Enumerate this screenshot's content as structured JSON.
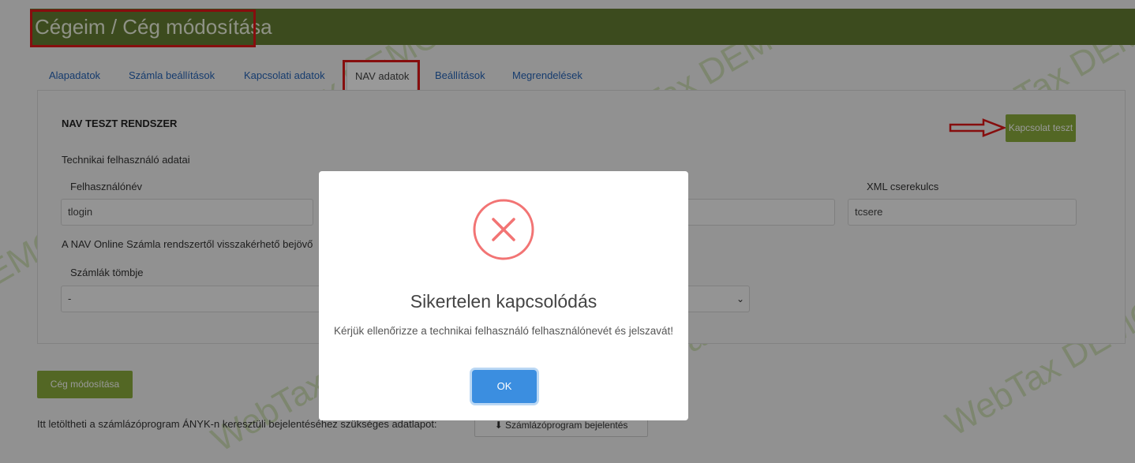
{
  "header": {
    "title": "Cégeim / Cég módosítása"
  },
  "tabs": [
    {
      "label": "Alapadatok"
    },
    {
      "label": "Számla beállítások"
    },
    {
      "label": "Kapcsolati adatok"
    },
    {
      "label": "NAV adatok"
    },
    {
      "label": "Beállítások"
    },
    {
      "label": "Megrendelések"
    }
  ],
  "nav_section": {
    "title": "NAV TESZT RENDSZER",
    "test_button": "Kapcsolat teszt",
    "tech_user_label": "Technikai felhasználó adatai",
    "username_label": "Felhasználónév",
    "username_value": "tlogin",
    "xml_key_label": "XML cserekulcs",
    "xml_key_value": "tcsere",
    "online_invoice_text": "A NAV Online Számla rendszertől visszakérhető bejövő",
    "invoice_block_label": "Számlák tömbje",
    "invoice_block_value": "-"
  },
  "footer": {
    "modify_button": "Cég módosítása",
    "anyk_text": "Itt letöltheti a számlázóprogram ÁNYK-n keresztüli bejelentéséhez szükséges adatlapot:",
    "anyk_button": "Számlázóprogram bejelentés"
  },
  "watermark_text": "WebTax DEMO",
  "modal": {
    "title": "Sikertelen kapcsolódás",
    "message": "Kérjük ellenőrizze a technikai felhasználó felhasználónevét és jelszavát!",
    "ok_label": "OK"
  },
  "colors": {
    "header": "#647e33",
    "accent_green": "#8aac3c",
    "annotation_red": "#e01818",
    "ok_blue": "#3b8ee0",
    "error_icon": "#f27474"
  }
}
